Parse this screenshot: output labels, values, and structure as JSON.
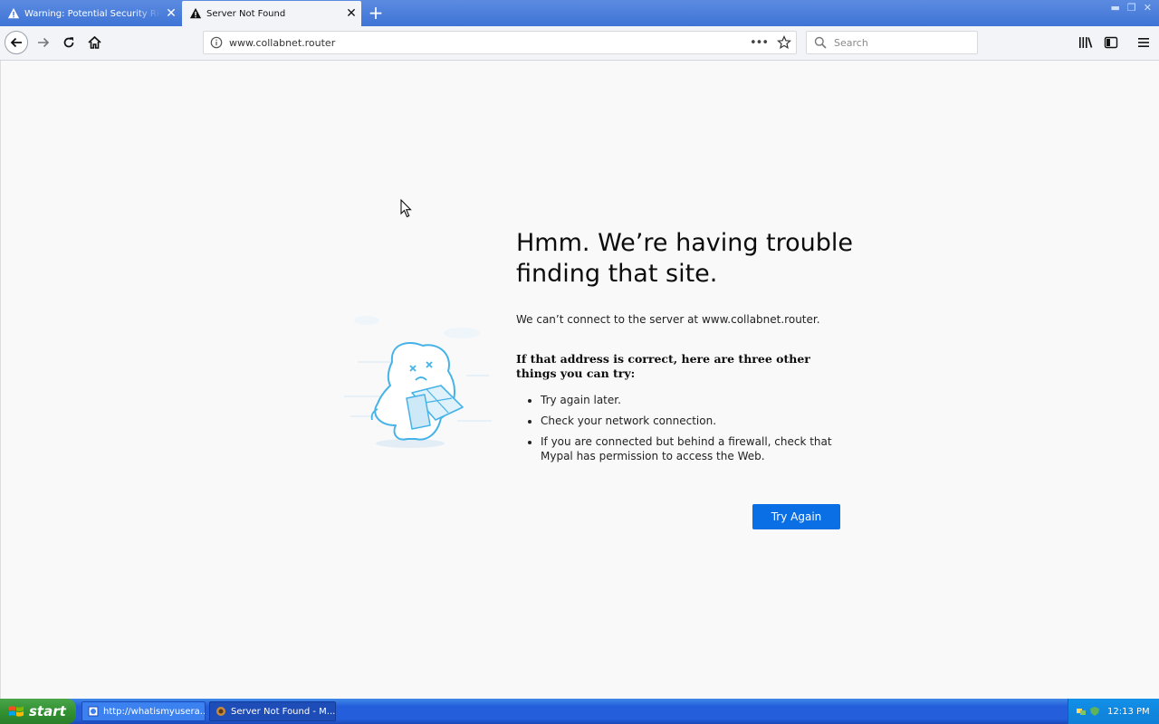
{
  "tabs": [
    {
      "title": "Warning: Potential Security Risk Ahead",
      "close": "✕"
    },
    {
      "title": "Server Not Found",
      "close": "✕"
    }
  ],
  "new_tab": "+",
  "urlbar": {
    "url": "www.collabnet.router",
    "page_actions": "•••"
  },
  "searchbar": {
    "placeholder": "Search"
  },
  "error_page": {
    "title": "Hmm. We’re having trouble finding that site.",
    "description": "We can’t connect to the server at www.collabnet.router.",
    "suggestions_heading": "If that address is correct, here are three other things you can try:",
    "suggestions": [
      "Try again later.",
      "Check your network connection.",
      "If you are connected but behind a firewall, check that Mypal has permission to access the Web."
    ],
    "try_again_label": "Try Again"
  },
  "taskbar": {
    "start_label": "start",
    "items": [
      {
        "label": "http://whatismyusera..."
      },
      {
        "label": "Server Not Found - M..."
      }
    ],
    "clock": "12:13 PM"
  },
  "colors": {
    "accent": "#0a6ee5",
    "tab_strip": "#4a7fdc",
    "taskbar": "#245edb",
    "start_button": "#329232",
    "illustration": "#45b3e8"
  },
  "icons": [
    "warning-icon",
    "close-icon",
    "plus-icon",
    "back-arrow-icon",
    "forward-arrow-icon",
    "reload-icon",
    "home-icon",
    "info-icon",
    "star-icon",
    "search-icon",
    "library-icon",
    "sidebar-icon",
    "hamburger-menu-icon",
    "windows-logo-icon",
    "tray-network-icon"
  ]
}
